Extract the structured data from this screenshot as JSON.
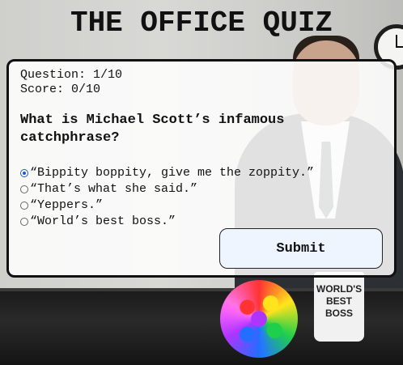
{
  "title": "THE OFFICE QUIZ",
  "quiz": {
    "question_counter": "Question: 1/10",
    "score": "Score: 0/10",
    "question_text": "What is Michael Scott’s infamous catchphrase?",
    "options": [
      {
        "label": "“Bippity boppity, give me the zoppity.”",
        "selected": true
      },
      {
        "label": "“That’s what she said.”",
        "selected": false
      },
      {
        "label": "“Yeppers.”",
        "selected": false
      },
      {
        "label": "“World’s best boss.”",
        "selected": false
      }
    ],
    "submit_label": "Submit"
  },
  "background": {
    "mug_text_line1": "WORLD'S",
    "mug_text_line2": "BEST",
    "mug_text_line3": "BOSS"
  },
  "colors": {
    "accent": "#1a56d6",
    "submit_bg": "#eef5ff"
  }
}
